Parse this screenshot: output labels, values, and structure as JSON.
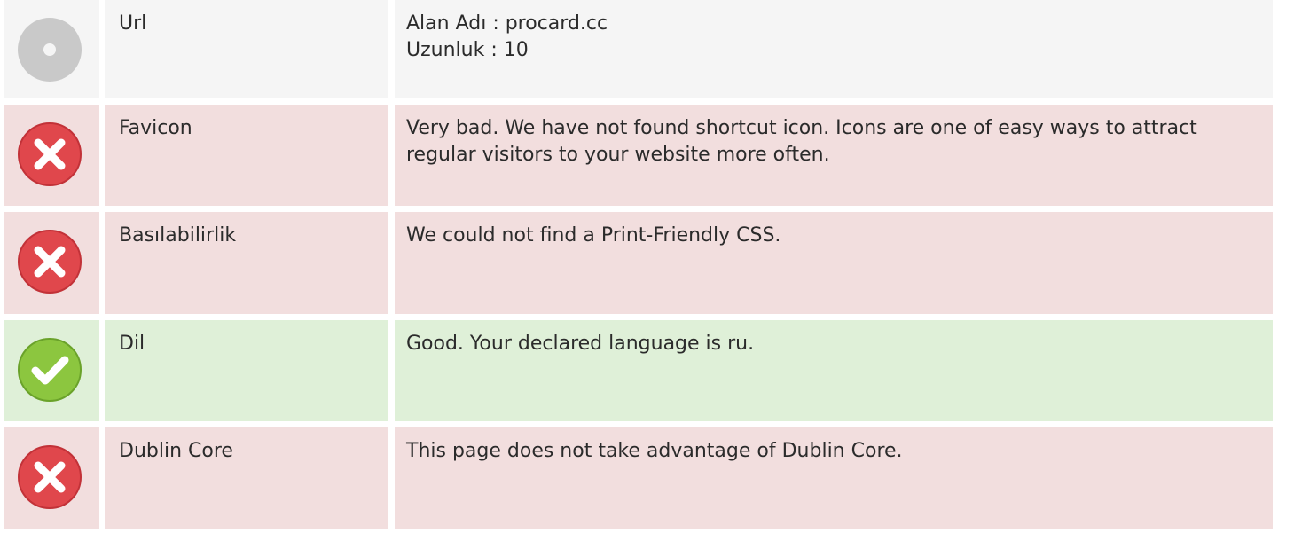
{
  "rows": [
    {
      "status": "neutral",
      "icon": "info-circle-icon",
      "label": "Url",
      "lines": [
        "Alan Adı : procard.cc",
        "Uzunluk : 10"
      ]
    },
    {
      "status": "bad",
      "icon": "error-x-icon",
      "label": "Favicon",
      "lines": [
        "Very bad. We have not found shortcut icon. Icons are one of easy ways to attract regular visitors to your website more often."
      ]
    },
    {
      "status": "bad",
      "icon": "error-x-icon",
      "label": "Basılabilirlik",
      "lines": [
        "We could not find a Print-Friendly CSS."
      ]
    },
    {
      "status": "good",
      "icon": "success-check-icon",
      "label": "Dil",
      "lines": [
        "Good. Your declared language is ru."
      ]
    },
    {
      "status": "bad",
      "icon": "error-x-icon",
      "label": "Dublin Core",
      "lines": [
        "This page does not take advantage of Dublin Core."
      ]
    }
  ],
  "colors": {
    "neutral": "#f5f5f5",
    "bad": "#f2dede",
    "good": "#dff0d8",
    "error_icon": "#e0474c",
    "success_icon": "#8cc63f",
    "neutral_icon": "#c8c8c8"
  }
}
